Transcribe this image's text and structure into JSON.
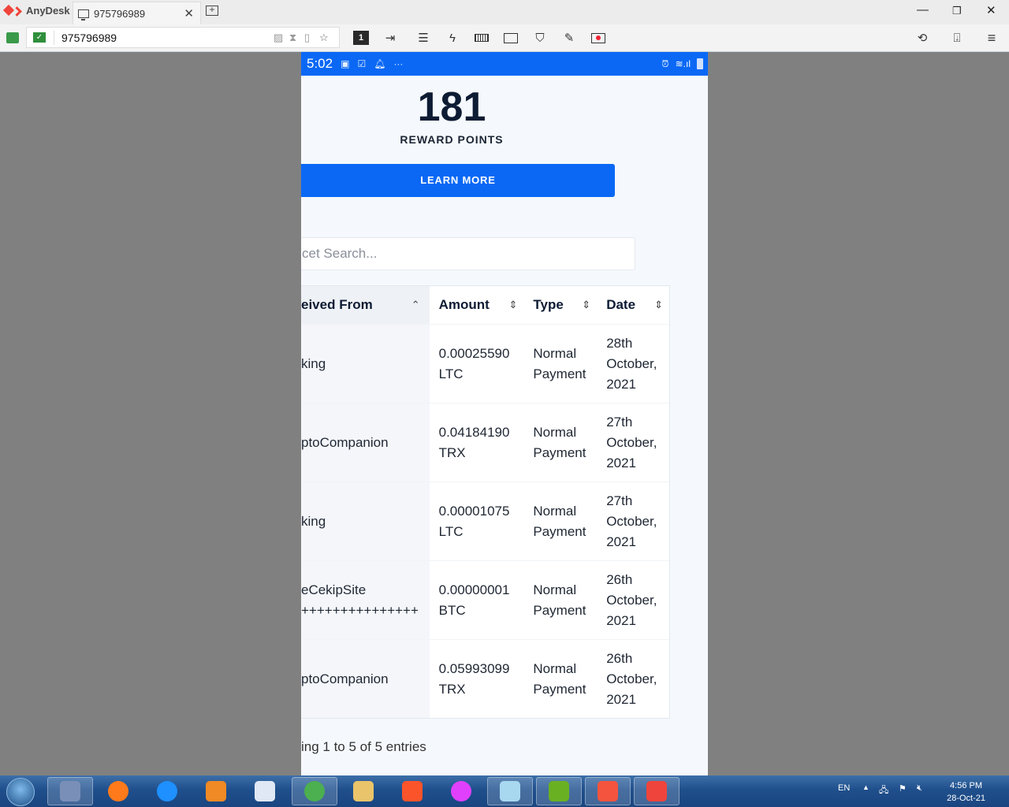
{
  "anydesk": {
    "app_name": "AnyDesk",
    "tab_title": "975796989",
    "address_value": "975796989",
    "icons": [
      "screen-off-icon",
      "hourglass-icon",
      "clipboard-icon",
      "favorite-star-icon"
    ],
    "toolbar_icons": [
      "display-1-icon",
      "file-transfer-icon",
      "chat-icon",
      "actions-icon",
      "keyboard-icon",
      "display-icon",
      "permissions-icon",
      "whiteboard-icon",
      "record-icon"
    ],
    "display_number": "1",
    "right_icons": [
      "history-icon",
      "install-icon",
      "menu-icon"
    ]
  },
  "phone": {
    "status_time": "5:02",
    "reward_points": "181",
    "reward_label": "REWARD POINTS",
    "learn_more": "LEARN MORE",
    "search_placeholder": "cet Search...",
    "table": {
      "headers": [
        "eived From",
        "Amount",
        "Type",
        "Date"
      ],
      "rows": [
        {
          "from": "king",
          "amount": "0.00025590",
          "currency": "LTC",
          "type1": "Normal",
          "type2": "Payment",
          "d1": "28th",
          "d2": "October,",
          "d3": "2021"
        },
        {
          "from": "ptoCompanion",
          "amount": "0.04184190",
          "currency": "TRX",
          "type1": "Normal",
          "type2": "Payment",
          "d1": "27th",
          "d2": "October,",
          "d3": "2021"
        },
        {
          "from": "king",
          "amount": "0.00001075",
          "currency": "LTC",
          "type1": "Normal",
          "type2": "Payment",
          "d1": "27th",
          "d2": "October,",
          "d3": "2021"
        },
        {
          "from": "eCekipSite",
          "from2": "+++++++++++++++",
          "amount": "0.00000001",
          "currency": "BTC",
          "type1": "Normal",
          "type2": "Payment",
          "d1": "26th",
          "d2": "October,",
          "d3": "2021"
        },
        {
          "from": "ptoCompanion",
          "amount": "0.05993099",
          "currency": "TRX",
          "type1": "Normal",
          "type2": "Payment",
          "d1": "26th",
          "d2": "October,",
          "d3": "2021"
        }
      ]
    },
    "footer": "ing 1 to 5 of 5 entries"
  },
  "taskbar": {
    "language": "EN",
    "time": "4:56 PM",
    "date": "28-Oct-21",
    "apps": [
      "media-app",
      "firefox",
      "internet-explorer",
      "media-player",
      "scanner",
      "chrome",
      "file-explorer",
      "brave",
      "color-wheel-app",
      "notepad",
      "camtasia-green",
      "camtasia-red",
      "anydesk"
    ]
  },
  "colors": {
    "accent": "#0a68f5",
    "anydesk_red": "#ef443b"
  }
}
